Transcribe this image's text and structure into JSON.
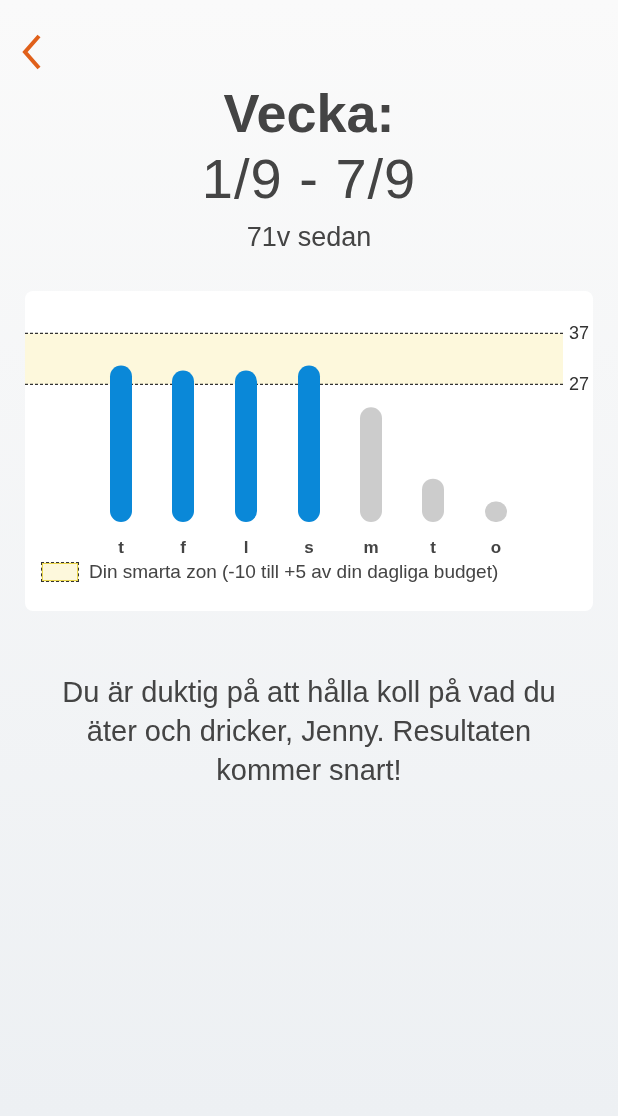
{
  "header": {
    "title": "Vecka:",
    "date_range": "1/9 - 7/9",
    "ago": "71v sedan"
  },
  "chart_data": {
    "type": "bar",
    "categories": [
      "t",
      "f",
      "l",
      "s",
      "m",
      "t",
      "o"
    ],
    "ylim": [
      0,
      37
    ],
    "yticks": [
      27,
      37
    ],
    "series": [
      {
        "color": "#0a88d8",
        "values": [
          30.7,
          29.7,
          29.7,
          30.7,
          null,
          null,
          null
        ]
      },
      {
        "color": "#cccccc",
        "values": [
          null,
          null,
          null,
          null,
          22.5,
          8.5,
          4
        ]
      }
    ],
    "bands": [
      {
        "axis": "y",
        "from": 27,
        "to": 37
      }
    ]
  },
  "legend": "Din smarta zon (-10 till +5 av din dagliga budget)",
  "message": "Du är duktig på att hålla koll på vad du äter och dricker, Jenny. Resultaten kommer snart!"
}
